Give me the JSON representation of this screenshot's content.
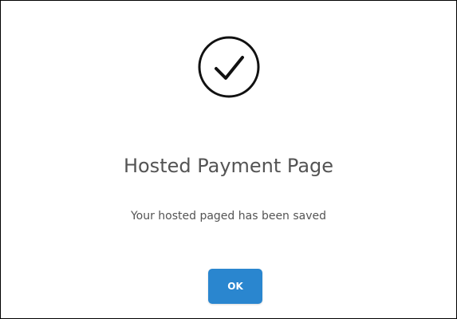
{
  "dialog": {
    "icon": "checkmark-circle-icon",
    "title": "Hosted Payment Page",
    "message": "Your hosted paged has been saved",
    "ok_label": "OK"
  },
  "colors": {
    "title_text": "#545454",
    "button_bg": "#2a86cf",
    "button_text": "#ffffff",
    "icon_stroke": "#111111"
  }
}
